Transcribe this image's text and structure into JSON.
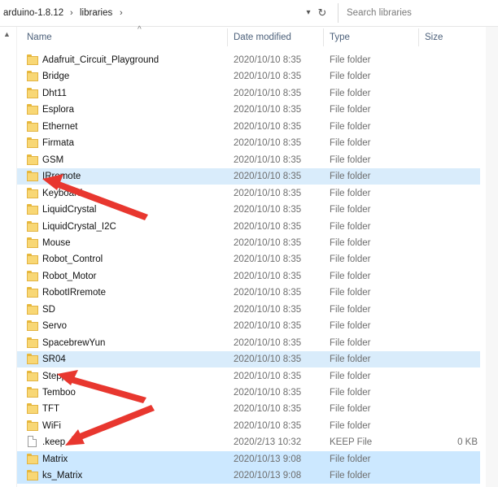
{
  "breadcrumb": [
    "arduino-1.8.12",
    "libraries"
  ],
  "breadcrumb_separator": "›",
  "search": {
    "placeholder": "Search libraries"
  },
  "columns": {
    "name": "Name",
    "date": "Date modified",
    "type": "Type",
    "size": "Size"
  },
  "icons": {
    "dropdown": "▾",
    "refresh": "↻",
    "up": "▲",
    "sort": "^"
  },
  "accent_color": "#cce8ff",
  "files": [
    {
      "name": "Adafruit_Circuit_Playground",
      "date": "2020/10/10 8:35",
      "type": "File folder",
      "size": "",
      "kind": "folder",
      "selected": false
    },
    {
      "name": "Bridge",
      "date": "2020/10/10 8:35",
      "type": "File folder",
      "size": "",
      "kind": "folder",
      "selected": false
    },
    {
      "name": "Dht11",
      "date": "2020/10/10 8:35",
      "type": "File folder",
      "size": "",
      "kind": "folder",
      "selected": false
    },
    {
      "name": "Esplora",
      "date": "2020/10/10 8:35",
      "type": "File folder",
      "size": "",
      "kind": "folder",
      "selected": false
    },
    {
      "name": "Ethernet",
      "date": "2020/10/10 8:35",
      "type": "File folder",
      "size": "",
      "kind": "folder",
      "selected": false
    },
    {
      "name": "Firmata",
      "date": "2020/10/10 8:35",
      "type": "File folder",
      "size": "",
      "kind": "folder",
      "selected": false
    },
    {
      "name": "GSM",
      "date": "2020/10/10 8:35",
      "type": "File folder",
      "size": "",
      "kind": "folder",
      "selected": false
    },
    {
      "name": "IRremote",
      "date": "2020/10/10 8:35",
      "type": "File folder",
      "size": "",
      "kind": "folder",
      "selected": true
    },
    {
      "name": "Keyboard",
      "date": "2020/10/10 8:35",
      "type": "File folder",
      "size": "",
      "kind": "folder",
      "selected": false
    },
    {
      "name": "LiquidCrystal",
      "date": "2020/10/10 8:35",
      "type": "File folder",
      "size": "",
      "kind": "folder",
      "selected": false
    },
    {
      "name": "LiquidCrystal_I2C",
      "date": "2020/10/10 8:35",
      "type": "File folder",
      "size": "",
      "kind": "folder",
      "selected": false
    },
    {
      "name": "Mouse",
      "date": "2020/10/10 8:35",
      "type": "File folder",
      "size": "",
      "kind": "folder",
      "selected": false
    },
    {
      "name": "Robot_Control",
      "date": "2020/10/10 8:35",
      "type": "File folder",
      "size": "",
      "kind": "folder",
      "selected": false
    },
    {
      "name": "Robot_Motor",
      "date": "2020/10/10 8:35",
      "type": "File folder",
      "size": "",
      "kind": "folder",
      "selected": false
    },
    {
      "name": "RobotIRremote",
      "date": "2020/10/10 8:35",
      "type": "File folder",
      "size": "",
      "kind": "folder",
      "selected": false
    },
    {
      "name": "SD",
      "date": "2020/10/10 8:35",
      "type": "File folder",
      "size": "",
      "kind": "folder",
      "selected": false
    },
    {
      "name": "Servo",
      "date": "2020/10/10 8:35",
      "type": "File folder",
      "size": "",
      "kind": "folder",
      "selected": false
    },
    {
      "name": "SpacebrewYun",
      "date": "2020/10/10 8:35",
      "type": "File folder",
      "size": "",
      "kind": "folder",
      "selected": false
    },
    {
      "name": "SR04",
      "date": "2020/10/10 8:35",
      "type": "File folder",
      "size": "",
      "kind": "folder",
      "selected": true
    },
    {
      "name": "Stepper",
      "date": "2020/10/10 8:35",
      "type": "File folder",
      "size": "",
      "kind": "folder",
      "selected": false
    },
    {
      "name": "Temboo",
      "date": "2020/10/10 8:35",
      "type": "File folder",
      "size": "",
      "kind": "folder",
      "selected": false
    },
    {
      "name": "TFT",
      "date": "2020/10/10 8:35",
      "type": "File folder",
      "size": "",
      "kind": "folder",
      "selected": false
    },
    {
      "name": "WiFi",
      "date": "2020/10/10 8:35",
      "type": "File folder",
      "size": "",
      "kind": "folder",
      "selected": false
    },
    {
      "name": ".keep",
      "date": "2020/2/13 10:32",
      "type": "KEEP File",
      "size": "0 KB",
      "kind": "file",
      "selected": false
    },
    {
      "name": "Matrix",
      "date": "2020/10/13 9:08",
      "type": "File folder",
      "size": "",
      "kind": "folder",
      "selected": true
    },
    {
      "name": "ks_Matrix",
      "date": "2020/10/13 9:08",
      "type": "File folder",
      "size": "",
      "kind": "folder",
      "selected": true
    }
  ]
}
